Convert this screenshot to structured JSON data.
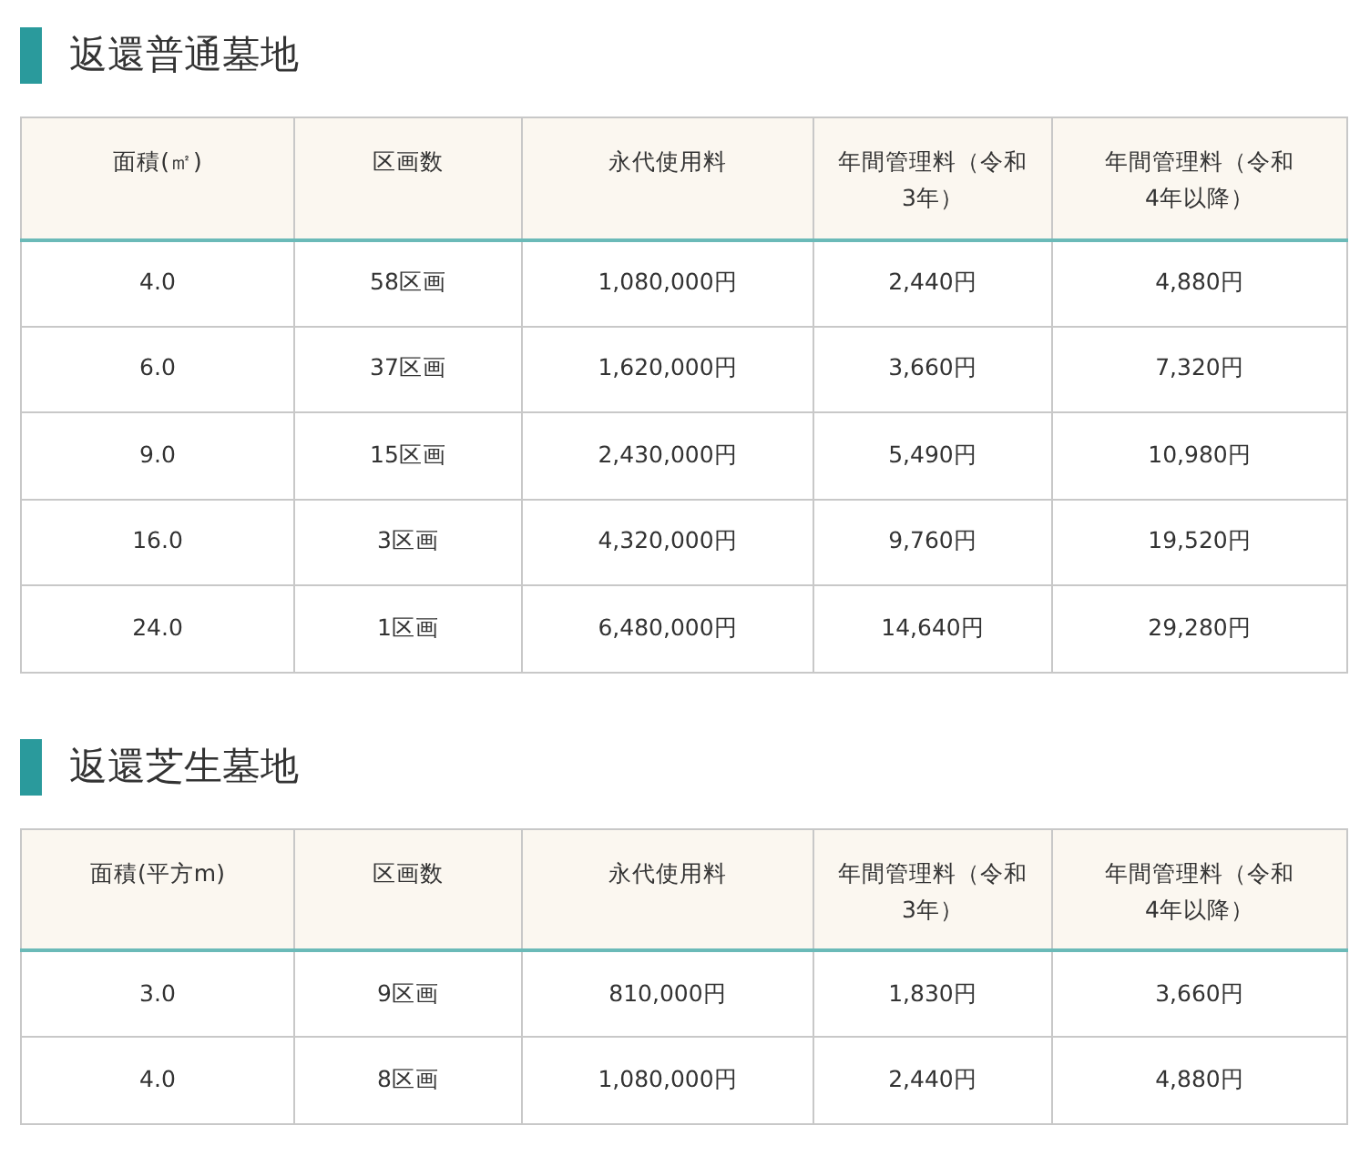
{
  "sections": [
    {
      "title": "返還普通墓地",
      "table": {
        "columns": [
          "面積(㎡)",
          "区画数",
          "永代使用料",
          "年間管理料（令和3年）",
          "年間管理料（令和4年以降）"
        ],
        "rows": [
          [
            "4.0",
            "58区画",
            "1,080,000円",
            "2,440円",
            "4,880円"
          ],
          [
            "6.0",
            "37区画",
            "1,620,000円",
            "3,660円",
            "7,320円"
          ],
          [
            "9.0",
            "15区画",
            "2,430,000円",
            "5,490円",
            "10,980円"
          ],
          [
            "16.0",
            "3区画",
            "4,320,000円",
            "9,760円",
            "19,520円"
          ],
          [
            "24.0",
            "1区画",
            "6,480,000円",
            "14,640円",
            "29,280円"
          ]
        ]
      }
    },
    {
      "title": "返還芝生墓地",
      "table": {
        "columns": [
          "面積(平方m)",
          "区画数",
          "永代使用料",
          "年間管理料（令和3年）",
          "年間管理料（令和4年以降）"
        ],
        "rows": [
          [
            "3.0",
            "9区画",
            "810,000円",
            "1,830円",
            "3,660円"
          ],
          [
            "4.0",
            "8区画",
            "1,080,000円",
            "2,440円",
            "4,880円"
          ]
        ]
      }
    }
  ]
}
